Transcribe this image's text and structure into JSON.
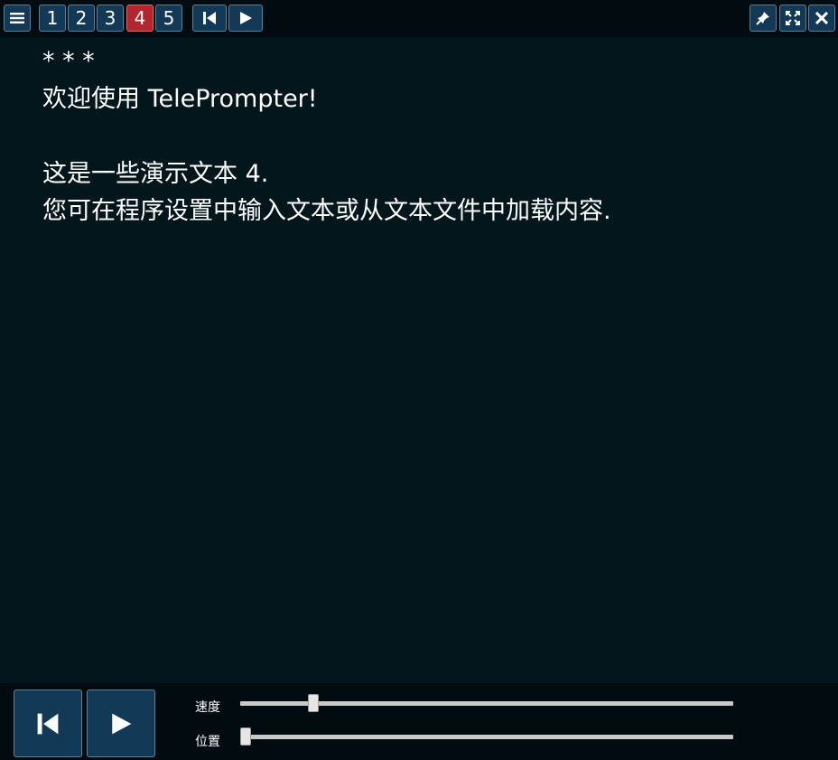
{
  "toolbar": {
    "menu_icon": "hamburger-menu-icon",
    "pages": [
      {
        "label": "1",
        "active": false
      },
      {
        "label": "2",
        "active": false
      },
      {
        "label": "3",
        "active": false
      },
      {
        "label": "4",
        "active": true
      },
      {
        "label": "5",
        "active": false
      }
    ],
    "restart_icon": "skip-to-start-icon",
    "play_icon": "play-icon",
    "pin_icon": "pin-icon",
    "fullscreen_icon": "fullscreen-icon",
    "close_icon": "close-icon"
  },
  "content": {
    "lines": [
      "* * *",
      "欢迎使用 TelePrompter!",
      "",
      "这是一些演示文本 4.",
      "您可在程序设置中输入文本或从文本文件中加载内容."
    ]
  },
  "controls": {
    "restart_icon": "skip-to-start-icon",
    "play_icon": "play-icon",
    "speed_label": "速度",
    "position_label": "位置",
    "speed_value": 0.14,
    "position_value": 0.0
  },
  "colors": {
    "background": "#03161c",
    "bar": "#020b0f",
    "button": "#123a57",
    "active_page": "#b3262d"
  }
}
